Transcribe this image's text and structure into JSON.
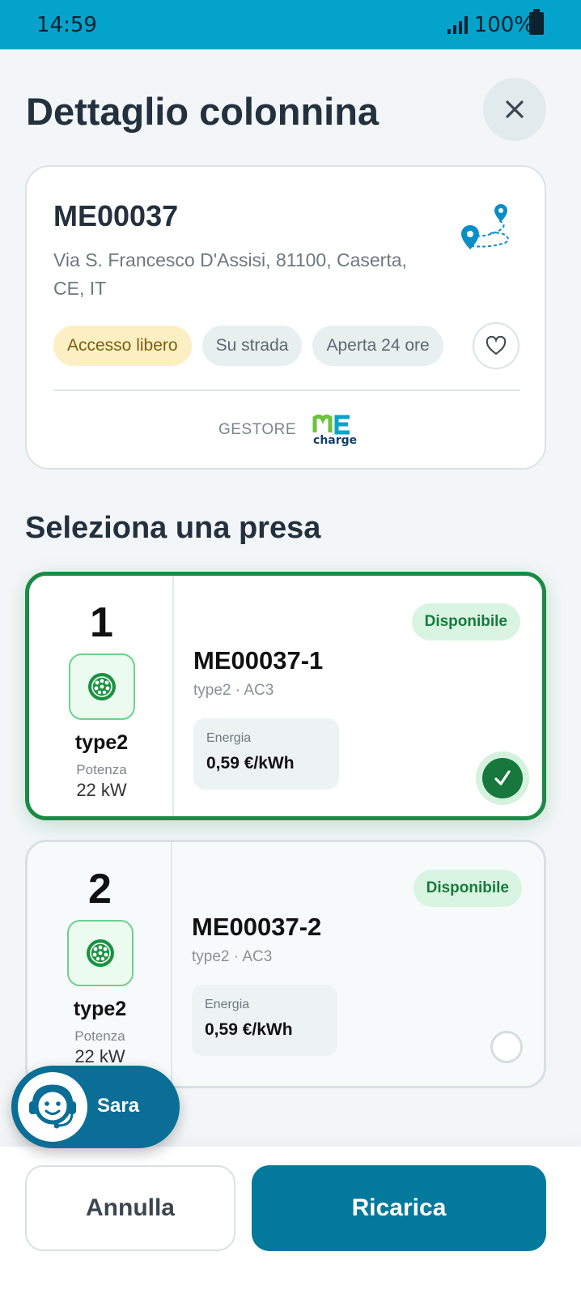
{
  "status_bar": {
    "time": "14:59",
    "battery": "100%"
  },
  "header": {
    "title": "Dettaglio colonnina"
  },
  "station": {
    "code": "ME00037",
    "address": "Via S. Francesco D'Assisi, 81100, Caserta, CE, IT",
    "chips": [
      "Accesso libero",
      "Su strada",
      "Aperta 24 ore"
    ],
    "operator_label": "GESTORE",
    "operator_logo_text": "charge"
  },
  "section": {
    "title": "Seleziona una presa"
  },
  "sockets": [
    {
      "number": "1",
      "type": "type2",
      "power_label": "Potenza",
      "power": "22 kW",
      "status": "Disponibile",
      "id": "ME00037-1",
      "desc": "type2 · AC3",
      "energy_label": "Energia",
      "energy_price": "0,59 €/kWh",
      "selected": true
    },
    {
      "number": "2",
      "type": "type2",
      "power_label": "Potenza",
      "power": "22 kW",
      "status": "Disponibile",
      "id": "ME00037-2",
      "desc": "type2 · AC3",
      "energy_label": "Energia",
      "energy_price": "0,59 €/kWh",
      "selected": false
    }
  ],
  "assistant": {
    "name": "Sara"
  },
  "actions": {
    "cancel": "Annulla",
    "charge": "Ricarica"
  },
  "colors": {
    "status_bar": "#03a3cc",
    "primary": "#03799c",
    "selected_border": "#1b8a45",
    "available_bg": "#d9f5e1"
  }
}
